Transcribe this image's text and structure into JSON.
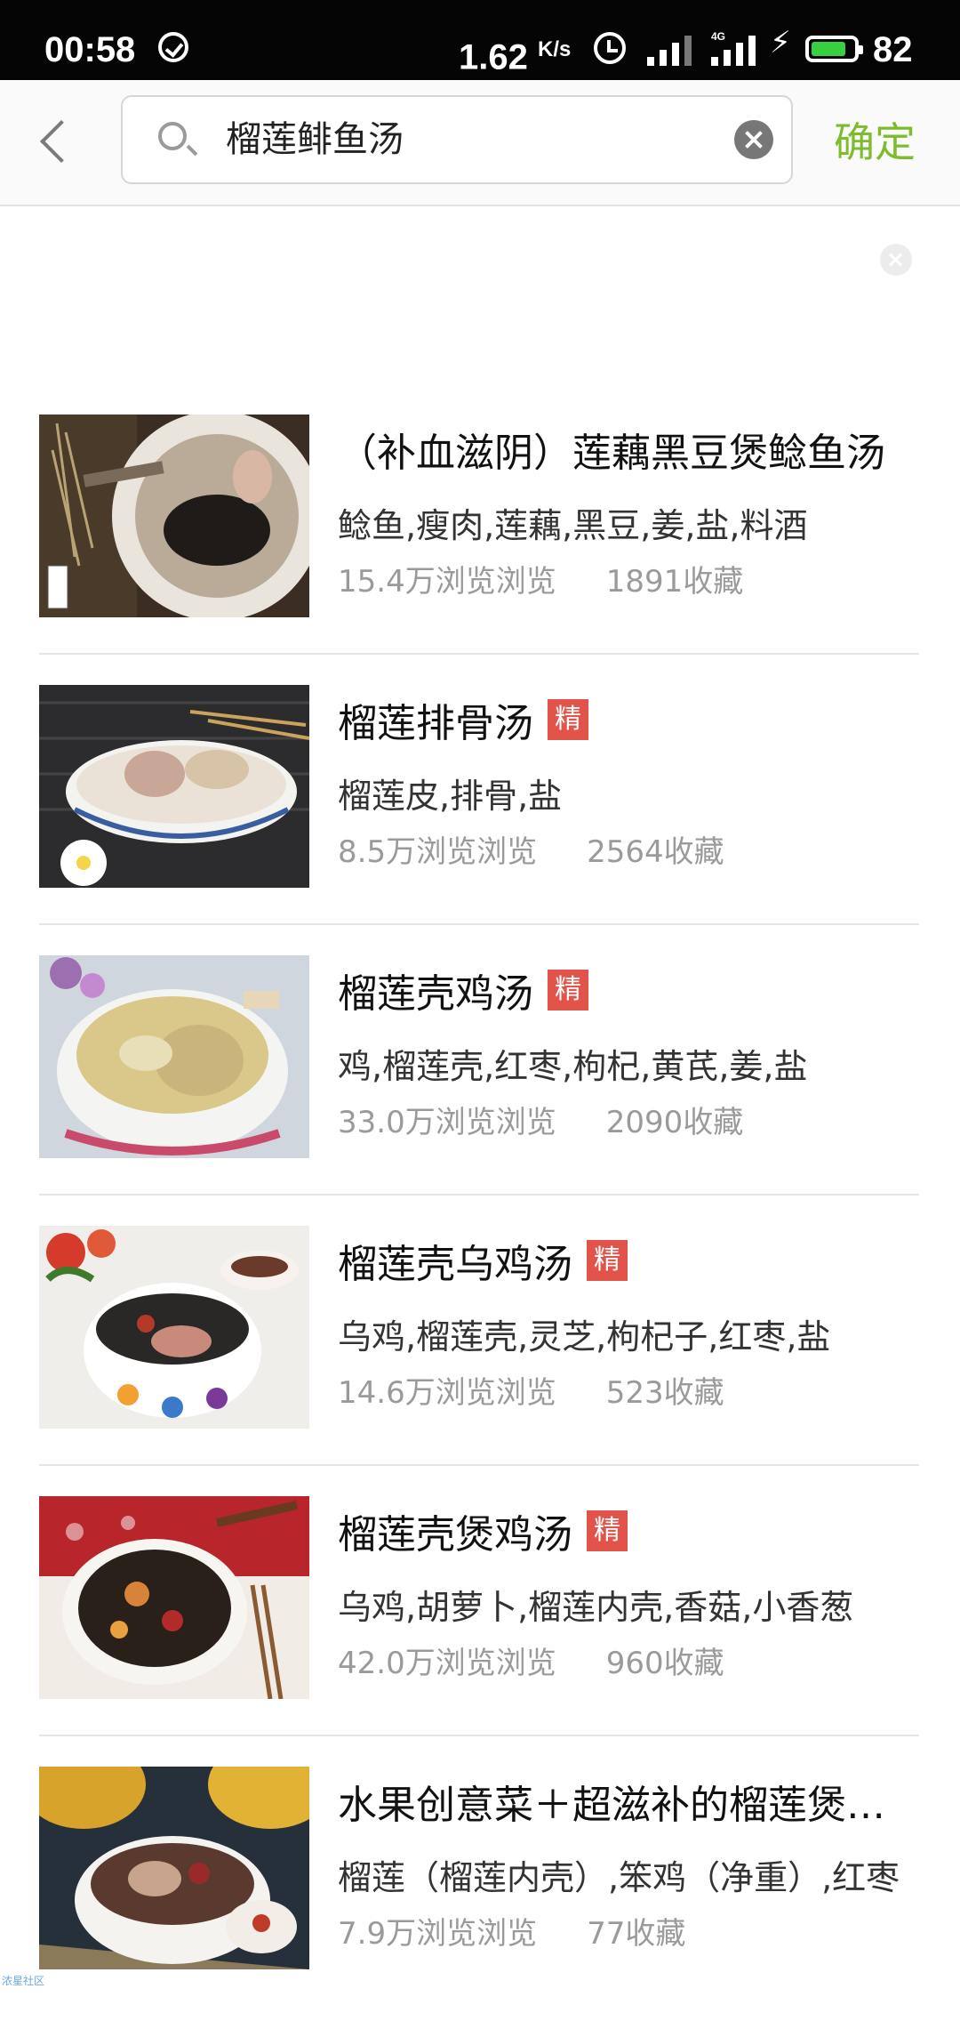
{
  "status_bar": {
    "time": "00:58",
    "speed": "1.62",
    "speed_unit": "K/s",
    "network": "4G",
    "battery_level": "82",
    "battery_fraction": 0.82,
    "battery_color": "#37d03e"
  },
  "search": {
    "query": "榴莲鲱鱼汤",
    "confirm_label": "确定"
  },
  "colors": {
    "accent": "#7dbd2c",
    "badge": "#e2534a"
  },
  "recipes": [
    {
      "title": "（补血滋阴）莲藕黑豆煲鲶鱼汤",
      "badge": "",
      "ingredients": "鲶鱼,瘦肉,莲藕,黑豆,姜,盐,料酒",
      "views": "15.4万浏览浏览",
      "favorites": "1891收藏"
    },
    {
      "title": "榴莲排骨汤",
      "badge": "精",
      "ingredients": "榴莲皮,排骨,盐",
      "views": "8.5万浏览浏览",
      "favorites": "2564收藏"
    },
    {
      "title": "榴莲壳鸡汤",
      "badge": "精",
      "ingredients": "鸡,榴莲壳,红枣,枸杞,黄芪,姜,盐",
      "views": "33.0万浏览浏览",
      "favorites": "2090收藏"
    },
    {
      "title": "榴莲壳乌鸡汤",
      "badge": "精",
      "ingredients": "乌鸡,榴莲壳,灵芝,枸杞子,红枣,盐",
      "views": "14.6万浏览浏览",
      "favorites": "523收藏"
    },
    {
      "title": "榴莲壳煲鸡汤",
      "badge": "精",
      "ingredients": "乌鸡,胡萝卜,榴莲内壳,香菇,小香葱",
      "views": "42.0万浏览浏览",
      "favorites": "960收藏"
    },
    {
      "title": "水果创意菜＋超滋补的榴莲煲鸡汤",
      "badge": "",
      "ingredients": "榴莲（榴莲内壳）,笨鸡（净重）,红枣",
      "views": "7.9万浏览浏览",
      "favorites": "77收藏"
    }
  ],
  "watermark": "浓星社区"
}
